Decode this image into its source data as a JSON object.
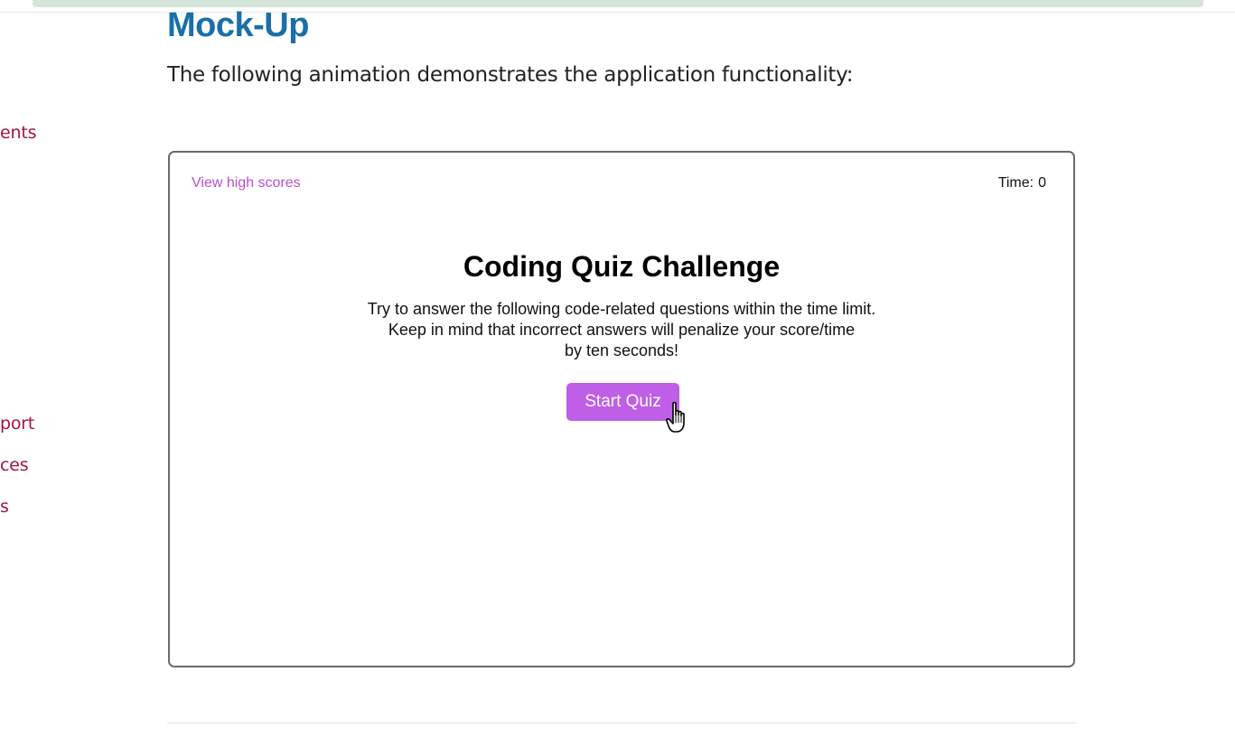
{
  "sidebar": {
    "items": [
      {
        "label": "ents"
      },
      {
        "label": "port"
      },
      {
        "label": "ces"
      },
      {
        "label": "s"
      }
    ]
  },
  "section": {
    "title": "Mock-Up",
    "intro": "The following animation demonstrates the application functionality:"
  },
  "quiz": {
    "view_scores": "View high scores",
    "time_label": "Time:",
    "time_value": "0",
    "title": "Coding Quiz Challenge",
    "description_lines": [
      "Try to answer the following code-related questions within the time limit.",
      "Keep in mind that incorrect answers will penalize your score/time",
      "by ten seconds!"
    ],
    "start_button": "Start Quiz"
  },
  "icons": {
    "cursor": "hand-pointer-icon"
  },
  "colors": {
    "heading": "#1a6fa8",
    "sidebar_link": "#a5123f",
    "view_scores_link": "#b84fd0",
    "start_button": "#bf5ee6",
    "frame_border": "#6a6a6a"
  }
}
